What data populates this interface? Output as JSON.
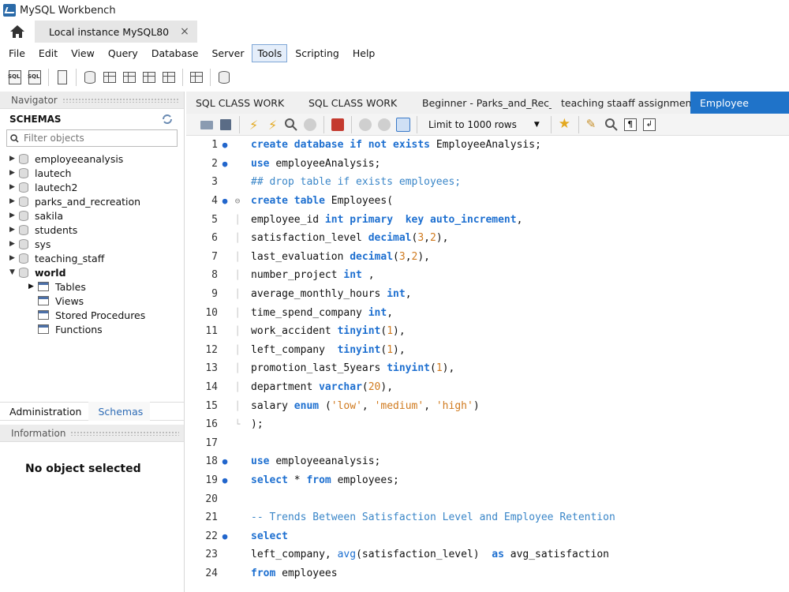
{
  "window": {
    "title": "MySQL Workbench"
  },
  "connection_tab": {
    "label": "Local instance MySQL80",
    "close": "×"
  },
  "menu": [
    "File",
    "Edit",
    "View",
    "Query",
    "Database",
    "Server",
    "Tools",
    "Scripting",
    "Help"
  ],
  "menu_active": "Tools",
  "navigator": {
    "header": "Navigator",
    "schemas_title": "SCHEMAS",
    "filter_placeholder": "Filter objects",
    "schemas": [
      "employeeanalysis",
      "lautech",
      "lautech2",
      "parks_and_recreation",
      "sakila",
      "students",
      "sys",
      "teaching_staff",
      "world"
    ],
    "expanded_schema": "world",
    "world_children": [
      "Tables",
      "Views",
      "Stored Procedures",
      "Functions"
    ],
    "bottom_tabs": [
      "Administration",
      "Schemas"
    ],
    "selected_bottom_tab": "Schemas",
    "info_header": "Information",
    "info_text": "No object selected"
  },
  "editor_tabs": [
    "SQL CLASS WORK",
    "SQL CLASS WORK",
    "Beginner - Parks_and_Rec_Cre...",
    "teaching staaff assignment",
    "Employee"
  ],
  "active_editor_tab": "Employee",
  "editor_toolbar": {
    "limit_label": "Limit to 1000 rows"
  },
  "code_lines": [
    {
      "n": "1",
      "mark": true,
      "fold": false,
      "text": "create database if not exists EmployeeAnalysis;"
    },
    {
      "n": "2",
      "mark": true,
      "fold": false,
      "text": "use employeeAnalysis;"
    },
    {
      "n": "3",
      "mark": false,
      "fold": false,
      "text": "## drop table if exists employees;"
    },
    {
      "n": "4",
      "mark": true,
      "fold": true,
      "text": "create table Employees("
    },
    {
      "n": "5",
      "mark": false,
      "fold": false,
      "text": "employee_id int primary  key auto_increment,"
    },
    {
      "n": "6",
      "mark": false,
      "fold": false,
      "text": "satisfaction_level decimal(3,2),"
    },
    {
      "n": "7",
      "mark": false,
      "fold": false,
      "text": "last_evaluation decimal(3,2),"
    },
    {
      "n": "8",
      "mark": false,
      "fold": false,
      "text": "number_project int ,"
    },
    {
      "n": "9",
      "mark": false,
      "fold": false,
      "text": "average_monthly_hours int,"
    },
    {
      "n": "10",
      "mark": false,
      "fold": false,
      "text": "time_spend_company int,"
    },
    {
      "n": "11",
      "mark": false,
      "fold": false,
      "text": "work_accident tinyint(1),"
    },
    {
      "n": "12",
      "mark": false,
      "fold": false,
      "text": "left_company  tinyint(1),"
    },
    {
      "n": "13",
      "mark": false,
      "fold": false,
      "text": "promotion_last_5years tinyint(1),"
    },
    {
      "n": "14",
      "mark": false,
      "fold": false,
      "text": "department varchar(20),"
    },
    {
      "n": "15",
      "mark": false,
      "fold": false,
      "text": "salary enum ('low', 'medium', 'high')"
    },
    {
      "n": "16",
      "mark": false,
      "fold": false,
      "text": ");"
    },
    {
      "n": "17",
      "mark": false,
      "fold": false,
      "text": ""
    },
    {
      "n": "18",
      "mark": true,
      "fold": false,
      "text": "use employeeanalysis;"
    },
    {
      "n": "19",
      "mark": true,
      "fold": false,
      "text": "select * from employees;"
    },
    {
      "n": "20",
      "mark": false,
      "fold": false,
      "text": ""
    },
    {
      "n": "21",
      "mark": false,
      "fold": false,
      "text": "-- Trends Between Satisfaction Level and Employee Retention"
    },
    {
      "n": "22",
      "mark": true,
      "fold": false,
      "text": "select"
    },
    {
      "n": "23",
      "mark": false,
      "fold": false,
      "text": "left_company, avg(satisfaction_level)  as avg_satisfaction"
    },
    {
      "n": "24",
      "mark": false,
      "fold": false,
      "text": "from employees"
    }
  ],
  "colors": {
    "active_tab": "#1f73c9",
    "keyword": "#1d6fd0",
    "number": "#d07a1e",
    "gutter_marker": "#2266cc"
  }
}
